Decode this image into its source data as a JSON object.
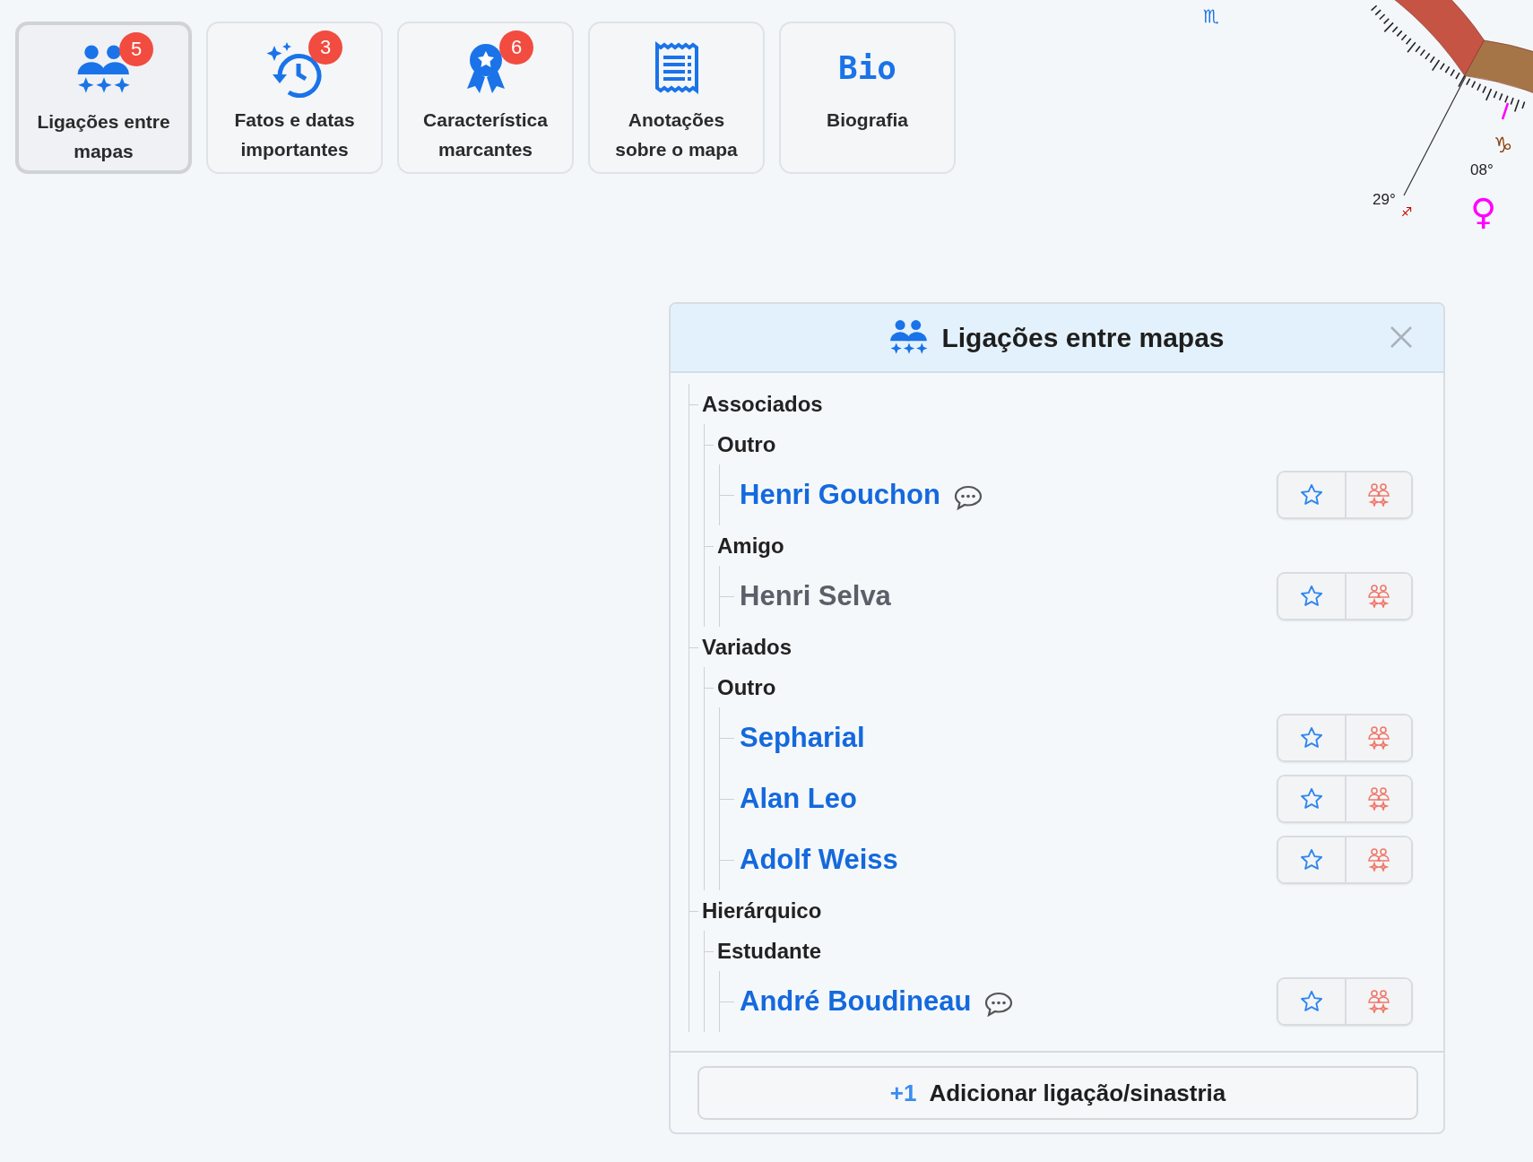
{
  "tabs": [
    {
      "kind": "people",
      "label": "Ligações entre mapas",
      "badge": "5",
      "selected": true
    },
    {
      "kind": "history",
      "label": "Fatos e datas importantes",
      "badge": "3",
      "selected": false
    },
    {
      "kind": "award",
      "label": "Característica marcantes",
      "badge": "6",
      "selected": false
    },
    {
      "kind": "notes",
      "label": "Anotações sobre o mapa",
      "selected": false
    },
    {
      "kind": "text",
      "icon_text": "Bio",
      "label": "Biografia",
      "selected": false
    }
  ],
  "wheel": {
    "marks": [
      "29°",
      "08°"
    ],
    "glyphs": [
      "♏",
      "♑",
      "♐",
      "♀"
    ]
  },
  "panel": {
    "title": "Ligações entre mapas",
    "groups": [
      {
        "label": "Associados",
        "children": [
          {
            "label": "Outro",
            "children": [
              {
                "name": "Henri Gouchon",
                "linked": true,
                "has_note": true
              }
            ]
          },
          {
            "label": "Amigo",
            "children": [
              {
                "name": "Henri Selva",
                "linked": false,
                "has_note": false
              }
            ]
          }
        ]
      },
      {
        "label": "Variados",
        "children": [
          {
            "label": "Outro",
            "children": [
              {
                "name": "Sepharial",
                "linked": true,
                "has_note": false
              },
              {
                "name": "Alan Leo",
                "linked": true,
                "has_note": false
              },
              {
                "name": "Adolf Weiss",
                "linked": true,
                "has_note": false
              }
            ]
          }
        ]
      },
      {
        "label": "Hierárquico",
        "children": [
          {
            "label": "Estudante",
            "children": [
              {
                "name": "André Boudineau",
                "linked": true,
                "has_note": true
              }
            ]
          }
        ]
      }
    ],
    "add_button": {
      "prefix": "+1",
      "label": "Adicionar ligação/sinastria"
    }
  }
}
